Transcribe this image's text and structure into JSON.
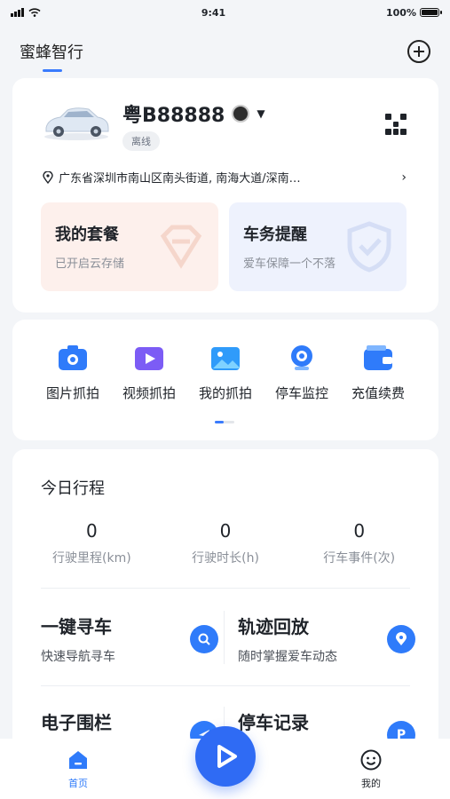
{
  "status_bar": {
    "time": "9:41",
    "battery": "100%",
    "battery_level": 1.0
  },
  "header": {
    "title": "蜜蜂智行",
    "add_icon": "plus-circle-icon"
  },
  "vehicle": {
    "plate": "粤B88888",
    "status": "离线",
    "location": "广东省深圳市南山区南头街道, 南海大道/深南…",
    "icons": [
      "car-image",
      "brand-logo-icon",
      "chevron-down-icon",
      "qr-code-icon",
      "location-pin-icon",
      "chevron-right-icon"
    ]
  },
  "tiles": [
    {
      "title": "我的套餐",
      "subtitle": "已开启云存储",
      "bg": "#fdf0ec"
    },
    {
      "title": "车务提醒",
      "subtitle": "爱车保障一个不落",
      "bg": "#eef2fd"
    }
  ],
  "functions": [
    {
      "label": "图片抓拍",
      "icon": "camera-icon",
      "color": "#2f7bfa"
    },
    {
      "label": "视频抓拍",
      "icon": "video-icon",
      "color": "#7c5cf5"
    },
    {
      "label": "我的抓拍",
      "icon": "image-icon",
      "color": "#2f9bfa"
    },
    {
      "label": "停车监控",
      "icon": "webcam-icon",
      "color": "#2f7bfa"
    },
    {
      "label": "充值续费",
      "icon": "wallet-icon",
      "color": "#2f7bfa"
    }
  ],
  "trip": {
    "title": "今日行程",
    "stats": [
      {
        "value": "0",
        "label": "行驶里程(km)"
      },
      {
        "value": "0",
        "label": "行驶时长(h)"
      },
      {
        "value": "0",
        "label": "行车事件(次)"
      }
    ]
  },
  "features": [
    {
      "title": "一键寻车",
      "subtitle": "快速导航寻车",
      "icon": "search-icon"
    },
    {
      "title": "轨迹回放",
      "subtitle": "随时掌握爱车动态",
      "icon": "location-pin-icon"
    },
    {
      "title": "电子围栏",
      "subtitle": "",
      "icon": "send-icon"
    },
    {
      "title": "停车记录",
      "subtitle": "",
      "icon": "parking-icon"
    }
  ],
  "tabbar": {
    "home": "首页",
    "me": "我的",
    "center_icon": "play-icon"
  },
  "colors": {
    "accent": "#2f7bfa",
    "background": "#f3f5f8"
  }
}
